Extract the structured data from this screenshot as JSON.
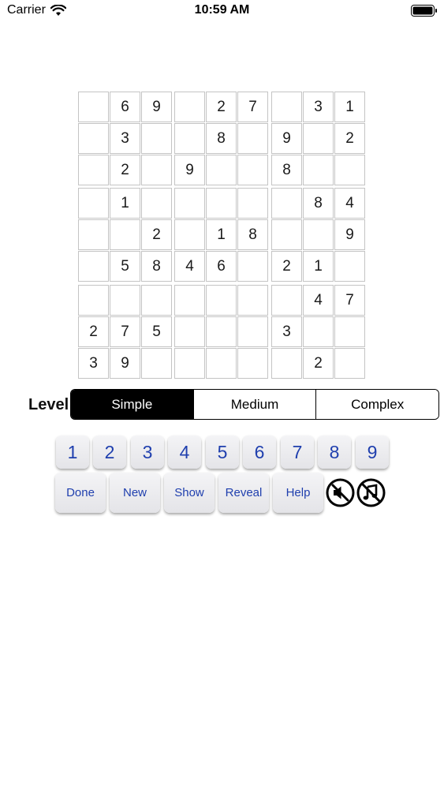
{
  "status_bar": {
    "carrier": "Carrier",
    "time": "10:59 AM",
    "icons": [
      "wifi-icon",
      "battery-icon"
    ]
  },
  "board": {
    "rows": [
      [
        "",
        "6",
        "9",
        "",
        "2",
        "7",
        "",
        "3",
        "1"
      ],
      [
        "",
        "3",
        "",
        "",
        "8",
        "",
        "9",
        "",
        "2"
      ],
      [
        "",
        "2",
        "",
        "9",
        "",
        "",
        "8",
        "",
        ""
      ],
      [
        "",
        "1",
        "",
        "",
        "",
        "",
        "",
        "8",
        "4"
      ],
      [
        "",
        "",
        "2",
        "",
        "1",
        "8",
        "",
        "",
        "9"
      ],
      [
        "",
        "5",
        "8",
        "4",
        "6",
        "",
        "2",
        "1",
        ""
      ],
      [
        "",
        "",
        "",
        "",
        "",
        "",
        "",
        "4",
        "7"
      ],
      [
        "2",
        "7",
        "5",
        "",
        "",
        "",
        "3",
        "",
        ""
      ],
      [
        "3",
        "9",
        "",
        "",
        "",
        "",
        "",
        "2",
        ""
      ]
    ]
  },
  "level": {
    "label": "Level:",
    "options": [
      "Simple",
      "Medium",
      "Complex"
    ],
    "selected": "Simple"
  },
  "keypad": {
    "numbers": [
      "1",
      "2",
      "3",
      "4",
      "5",
      "6",
      "7",
      "8",
      "9"
    ],
    "actions": {
      "done": "Done",
      "new": "New",
      "show": "Show",
      "reveal": "Reveal",
      "help": "Help"
    },
    "toggle_icons": [
      "sound-muted-icon",
      "music-off-icon"
    ]
  },
  "colors": {
    "key_text": "#1f3fae",
    "selected_segment": "#000000",
    "grid_line": "#c4c4c4"
  }
}
